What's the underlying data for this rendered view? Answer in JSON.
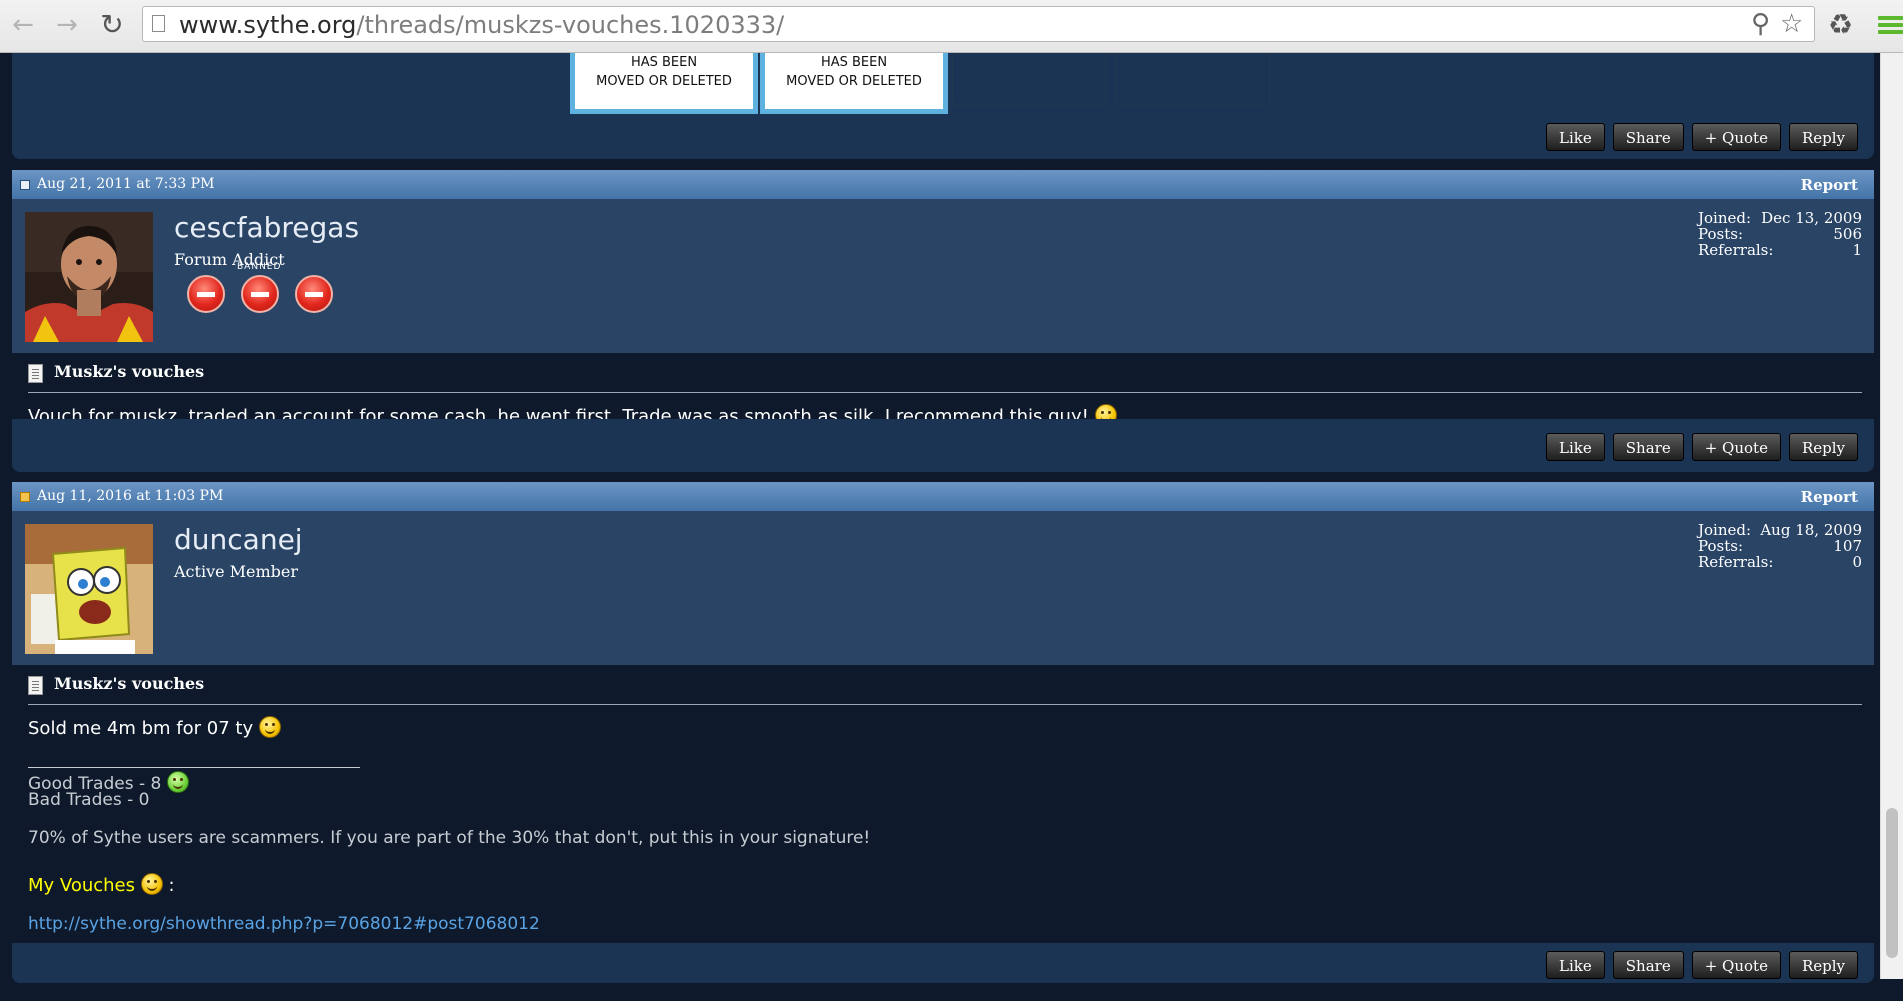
{
  "browser": {
    "url_host": "www.sythe.org",
    "url_path": "/threads/muskzs-vouches.1020333/",
    "back_icon": "arrow-left-icon",
    "forward_icon": "arrow-right-icon",
    "reload_icon": "reload-icon",
    "zoom_icon": "magnifier-icon",
    "star_icon": "star-icon",
    "extension_icon": "puzzle-icon",
    "menu_icon": "hamburger-menu-icon"
  },
  "previous_post": {
    "moved_images": [
      {
        "line1": "HAS BEEN",
        "line2": "MOVED OR DELETED"
      },
      {
        "line1": "HAS BEEN",
        "line2": "MOVED OR DELETED"
      }
    ]
  },
  "actions": {
    "like": "Like",
    "share": "Share",
    "quote": "+ Quote",
    "reply": "Reply"
  },
  "posts": [
    {
      "date": "Aug 21, 2011 at 7:33 PM",
      "report": "Report",
      "username": "cescfabregas",
      "user_title": "Forum Addict",
      "banned_label": "BANNED",
      "stats": {
        "joined_label": "Joined:",
        "joined": "Dec 13, 2009",
        "posts_label": "Posts:",
        "posts": "506",
        "referrals_label": "Referrals:",
        "referrals": "1"
      },
      "title": "Muskz's vouches",
      "message": "Vouch for muskz, traded an account for some cash, he went first. Trade was as smooth as silk, I recommend this guy!"
    },
    {
      "date": "Aug 11, 2016 at 11:03 PM",
      "report": "Report",
      "username": "duncanej",
      "user_title": "Active Member",
      "stats": {
        "joined_label": "Joined:",
        "joined": "Aug 18, 2009",
        "posts_label": "Posts:",
        "posts": "107",
        "referrals_label": "Referrals:",
        "referrals": "0"
      },
      "title": "Muskz's vouches",
      "message": "Sold me 4m bm for 07 ty",
      "signature": {
        "good_trades": "Good Trades - 8",
        "bad_trades": "Bad Trades - 0",
        "scammer_note": "70% of Sythe users are scammers. If you are part of the 30% that don't, put this in your signature!",
        "vouches_label": "My Vouches",
        "vouches_suffix": " :",
        "vouches_link": "http://sythe.org/showthread.php?p=7068012#post7068012"
      }
    }
  ],
  "colors": {
    "page_bg": "#0e1a2b",
    "post_bg": "#2a4466",
    "header_bar": "#4474a8",
    "link": "#5aa3e4",
    "highlight": "#ffff00"
  }
}
